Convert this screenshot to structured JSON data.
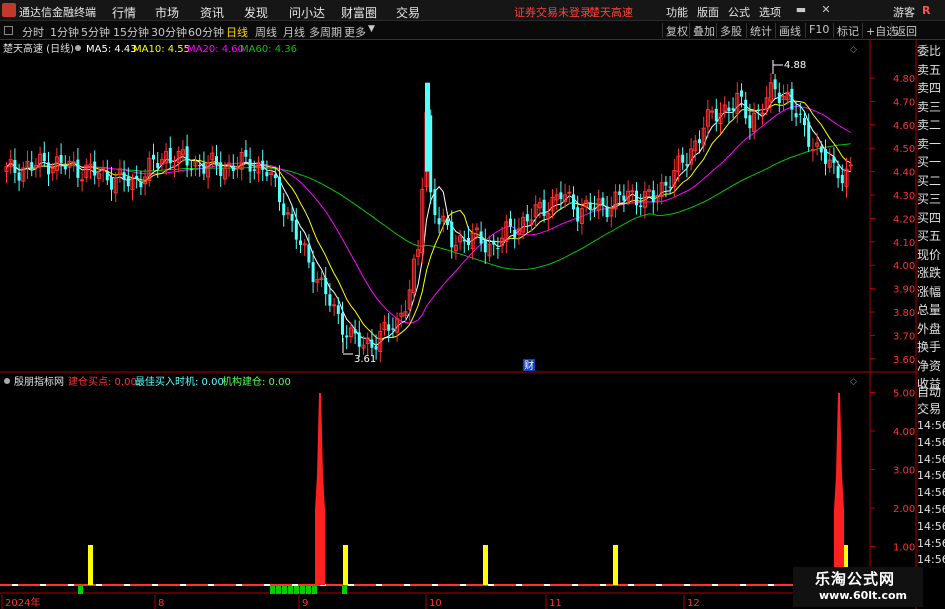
{
  "app": {
    "title": "通达信金融终端",
    "menus": [
      "行情",
      "市场",
      "资讯",
      "发现",
      "问小达",
      "财富圈",
      "交易"
    ],
    "notice": "证券交易未登录",
    "stock_name_header": "楚天高速",
    "right_menus": [
      "功能",
      "版面",
      "公式",
      "选项"
    ],
    "user": "游客",
    "r_label": "R"
  },
  "periods": {
    "tabs": [
      "分时",
      "1分钟",
      "5分钟",
      "15分钟",
      "30分钟",
      "60分钟",
      "日线",
      "周线",
      "月线",
      "多周期",
      "更多"
    ],
    "active": "日线",
    "tools": [
      "复权",
      "叠加",
      "多股",
      "统计",
      "画线",
      "F10",
      "标记",
      "+自选",
      "返回"
    ]
  },
  "main_chart": {
    "title": "楚天高速 (日线)",
    "ma5": "MA5: 4.43",
    "ma10": "MA10: 4.55",
    "ma20": "MA20: 4.60",
    "ma60": "MA60: 4.36",
    "high_label": "4.88",
    "low_label": "3.61",
    "cai_label": "财",
    "price_ticks": [
      "4.80",
      "4.70",
      "4.60",
      "4.50",
      "4.40",
      "4.30",
      "4.20",
      "4.10",
      "4.00",
      "3.90",
      "3.80",
      "3.70",
      "3.60"
    ],
    "colors": {
      "up": "#ff3232",
      "down": "#54ffff",
      "ma5": "#ffffff",
      "ma10": "#ffff00",
      "ma20": "#ff00ff",
      "ma60": "#00c800"
    }
  },
  "indicator": {
    "title": "殷朋指标网",
    "l1": "建仓买点: 0.00",
    "l2": "最佳买入时机: 0.00",
    "l3": "机构建仓: 0.00",
    "ticks": [
      "5.00",
      "4.00",
      "3.00",
      "2.00",
      "1.00"
    ]
  },
  "x_axis": [
    "2024年",
    "8",
    "9",
    "10",
    "11",
    "12"
  ],
  "side_labels": [
    "委比",
    "卖五",
    "卖四",
    "卖三",
    "卖二",
    "卖一",
    "买一",
    "买二",
    "买三",
    "买四",
    "买五",
    "现价",
    "涨跌",
    "涨幅",
    "总量",
    "外盘",
    "换手",
    "净资",
    "收益"
  ],
  "side_labels2": [
    "自动",
    "交易"
  ],
  "side_times": [
    "14:56",
    "14:56",
    "14:56",
    "14:56",
    "14:56",
    "14:56",
    "14:56",
    "14:56",
    "14:56"
  ],
  "watermark": {
    "line1": "乐淘公式网",
    "line2": "www.60lt.com"
  }
}
